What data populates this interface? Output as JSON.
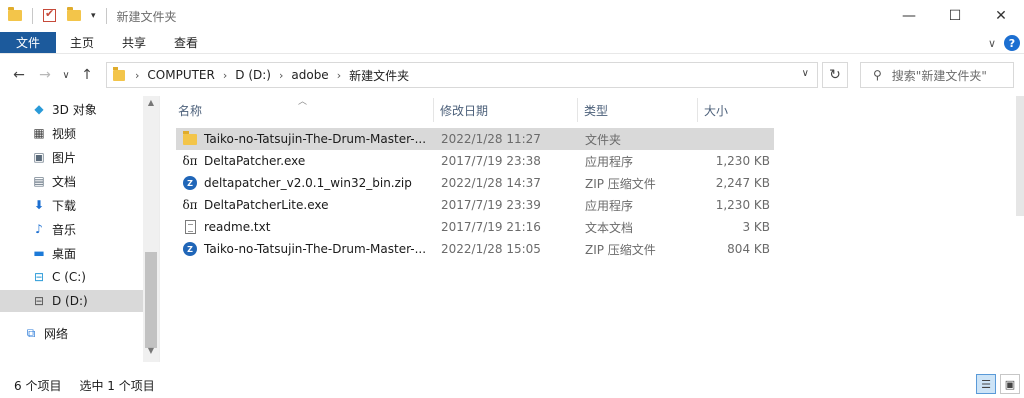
{
  "window": {
    "title": "新建文件夹",
    "minimize": "—",
    "maximize": "☐",
    "close": "✕"
  },
  "ribbon": {
    "file": "文件",
    "tabs": [
      "主页",
      "共享",
      "查看"
    ],
    "collapse": "∨",
    "help": "?"
  },
  "nav": {
    "back": "←",
    "forward": "→",
    "recent": "∨",
    "up": "↑",
    "breadcrumb": [
      "COMPUTER",
      "D (D:)",
      "adobe",
      "新建文件夹"
    ],
    "crumb_sep": "›",
    "address_drop": "∨",
    "refresh": "↻",
    "search_placeholder": "搜索\"新建文件夹\""
  },
  "sidebar": {
    "items": [
      {
        "label": "3D 对象",
        "icon": "cube-icon"
      },
      {
        "label": "视频",
        "icon": "video-icon"
      },
      {
        "label": "图片",
        "icon": "picture-icon"
      },
      {
        "label": "文档",
        "icon": "document-icon"
      },
      {
        "label": "下载",
        "icon": "download-icon"
      },
      {
        "label": "音乐",
        "icon": "music-icon"
      },
      {
        "label": "桌面",
        "icon": "desktop-icon"
      },
      {
        "label": "C (C:)",
        "icon": "drive-c-icon"
      },
      {
        "label": "D (D:)",
        "icon": "drive-d-icon",
        "selected": true
      },
      {
        "label": "网络",
        "icon": "network-icon"
      }
    ]
  },
  "columns": {
    "name": "名称",
    "date": "修改日期",
    "type": "类型",
    "size": "大小"
  },
  "files": [
    {
      "name": "Taiko-no-Tatsujin-The-Drum-Master-...",
      "date": "2022/1/28 11:27",
      "type": "文件夹",
      "size": "",
      "icon": "folder-icon",
      "selected": true
    },
    {
      "name": "DeltaPatcher.exe",
      "date": "2017/7/19 23:38",
      "type": "应用程序",
      "size": "1,230 KB",
      "icon": "exe-icon"
    },
    {
      "name": "deltapatcher_v2.0.1_win32_bin.zip",
      "date": "2022/1/28 14:37",
      "type": "ZIP 压缩文件",
      "size": "2,247 KB",
      "icon": "zip-icon"
    },
    {
      "name": "DeltaPatcherLite.exe",
      "date": "2017/7/19 23:39",
      "type": "应用程序",
      "size": "1,230 KB",
      "icon": "exe-icon"
    },
    {
      "name": "readme.txt",
      "date": "2017/7/19 21:16",
      "type": "文本文档",
      "size": "3 KB",
      "icon": "text-file-icon"
    },
    {
      "name": "Taiko-no-Tatsujin-The-Drum-Master-...",
      "date": "2022/1/28 15:05",
      "type": "ZIP 压缩文件",
      "size": "804 KB",
      "icon": "zip-icon"
    }
  ],
  "status": {
    "count": "6 个项目",
    "selected": "选中 1 个项目"
  }
}
